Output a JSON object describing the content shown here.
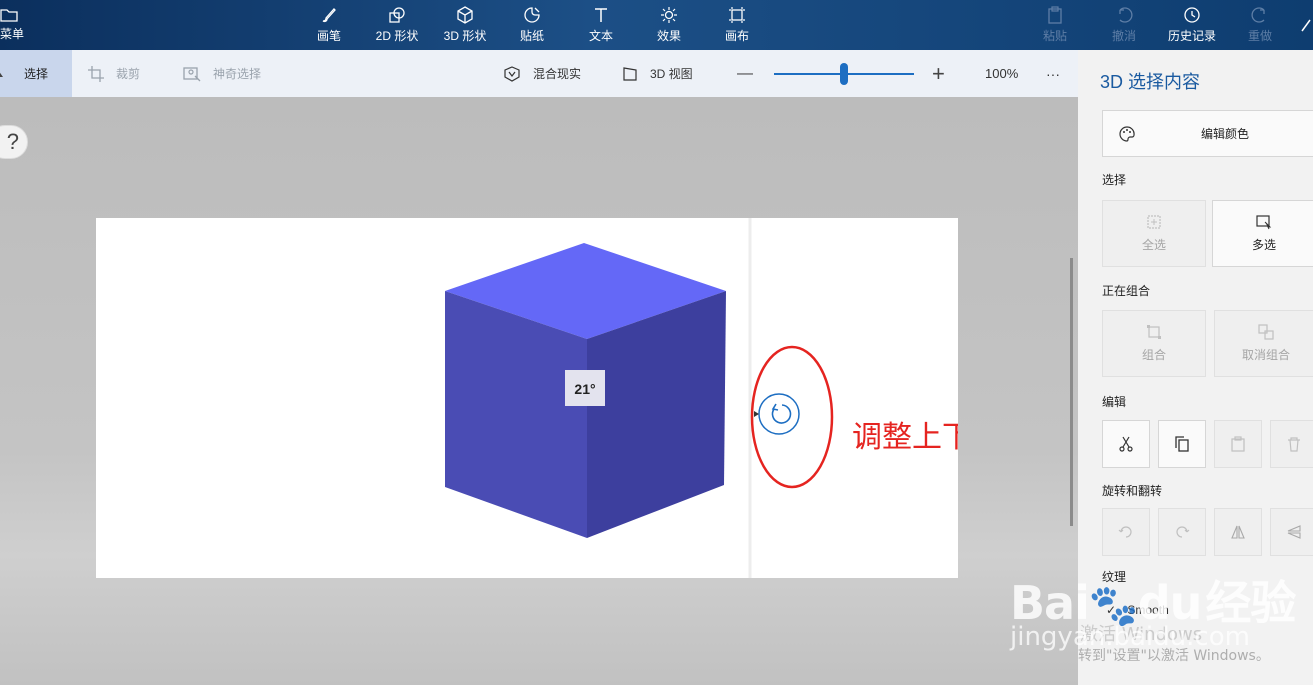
{
  "toolbar": {
    "menu_label": "菜单",
    "items": [
      {
        "label": "画笔",
        "icon": "brush-icon"
      },
      {
        "label": "2D 形状",
        "icon": "2d-shapes-icon"
      },
      {
        "label": "3D 形状",
        "icon": "3d-shapes-icon"
      },
      {
        "label": "贴纸",
        "icon": "sticker-icon"
      },
      {
        "label": "文本",
        "icon": "text-icon"
      },
      {
        "label": "效果",
        "icon": "effects-icon"
      },
      {
        "label": "画布",
        "icon": "canvas-icon"
      }
    ],
    "right_items": [
      {
        "label": "粘贴",
        "icon": "paste-icon",
        "enabled": false
      },
      {
        "label": "撤消",
        "icon": "undo-icon",
        "enabled": false
      },
      {
        "label": "历史记录",
        "icon": "history-icon",
        "enabled": true
      },
      {
        "label": "重做",
        "icon": "redo-icon",
        "enabled": false
      }
    ]
  },
  "subtoolbar": {
    "select_label": "选择",
    "crop_label": "裁剪",
    "magic_select_label": "神奇选择",
    "mixed_reality_label": "混合现实",
    "view_3d_label": "3D 视图",
    "zoom_out": "—",
    "zoom_in": "+",
    "zoom_level": "100%",
    "zoom_fraction": 0.47,
    "more": "···"
  },
  "help": {
    "label": "?"
  },
  "canvas": {
    "cube_color_top": "#6468f7",
    "cube_color_left": "#4a4cb4",
    "cube_color_right": "#3d3f9e",
    "angle_tooltip": "21°",
    "annotation": "调整上下角度",
    "annotation_color": "#e52420"
  },
  "panel": {
    "title": "3D 选择内容",
    "edit_color_label": "编辑颜色",
    "sections": {
      "select": "选择",
      "group": "正在组合",
      "edit": "编辑",
      "rotate": "旋转和翻转",
      "texture": "纹理"
    },
    "select_all": "全选",
    "multi_select": "多选",
    "group": "组合",
    "ungroup": "取消组合",
    "texture_option": "Smooth"
  },
  "watermark": {
    "baidu": "Bai",
    "du": "du",
    "jingyan": "经验",
    "url": "jingyan.baidu.com",
    "activate_title": "激活 Windows",
    "activate_sub": "转到\"设置\"以激活 Windows。"
  }
}
